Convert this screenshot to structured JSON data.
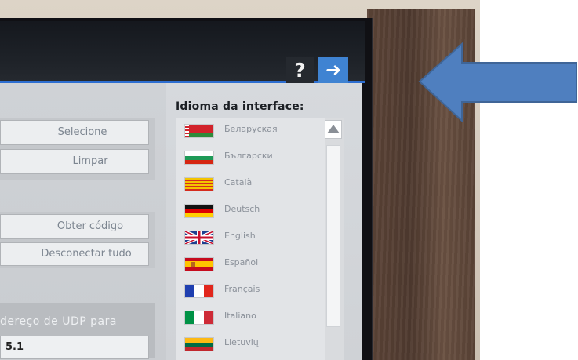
{
  "toolbar": {
    "help_label": "?",
    "next_label": "➜"
  },
  "left_panel": {
    "select_button": "Selecione",
    "clear_button": "Limpar",
    "get_code_button": "Obter código",
    "disconnect_all_button": "Desconectar tudo",
    "udp_label": "dereço de UDP para",
    "udp_value": "5.1"
  },
  "language_panel": {
    "title": "Idioma da interface:",
    "languages": [
      {
        "name": "Беларуская"
      },
      {
        "name": "Български"
      },
      {
        "name": "Català"
      },
      {
        "name": "Deutsch"
      },
      {
        "name": "English"
      },
      {
        "name": "Español"
      },
      {
        "name": "Français"
      },
      {
        "name": "Italiano"
      },
      {
        "name": "Lietuvių"
      }
    ]
  },
  "colors": {
    "accent_blue": "#3f83d2",
    "pointer_arrow": "#4f7fbf"
  },
  "icons": {
    "help": "question-mark-icon",
    "next": "arrow-right-icon",
    "scroll_up": "triangle-up-icon"
  }
}
